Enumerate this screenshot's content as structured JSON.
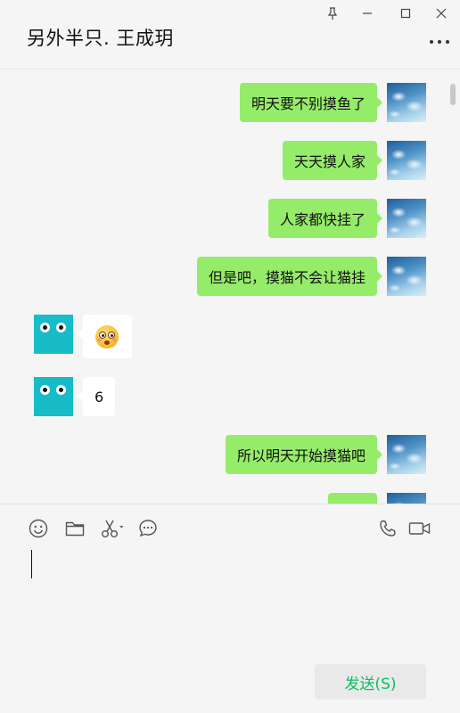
{
  "header": {
    "title": "另外半只. 王成玥"
  },
  "messages": [
    {
      "side": "me",
      "text": "明天要不别摸鱼了"
    },
    {
      "side": "me",
      "text": "天天摸人家"
    },
    {
      "side": "me",
      "text": "人家都快挂了"
    },
    {
      "side": "me",
      "text": "但是吧，摸猫不会让猫挂"
    },
    {
      "side": "other",
      "text": "",
      "emoji": "flushed-emoji"
    },
    {
      "side": "other",
      "text": "6"
    },
    {
      "side": "me",
      "text": "所以明天开始摸猫吧"
    }
  ],
  "compose": {
    "send_label": "发送(S)"
  },
  "colors": {
    "my_bubble": "#95ec69",
    "other_bubble": "#ffffff",
    "send_text": "#07c160",
    "background": "#f5f5f5"
  }
}
